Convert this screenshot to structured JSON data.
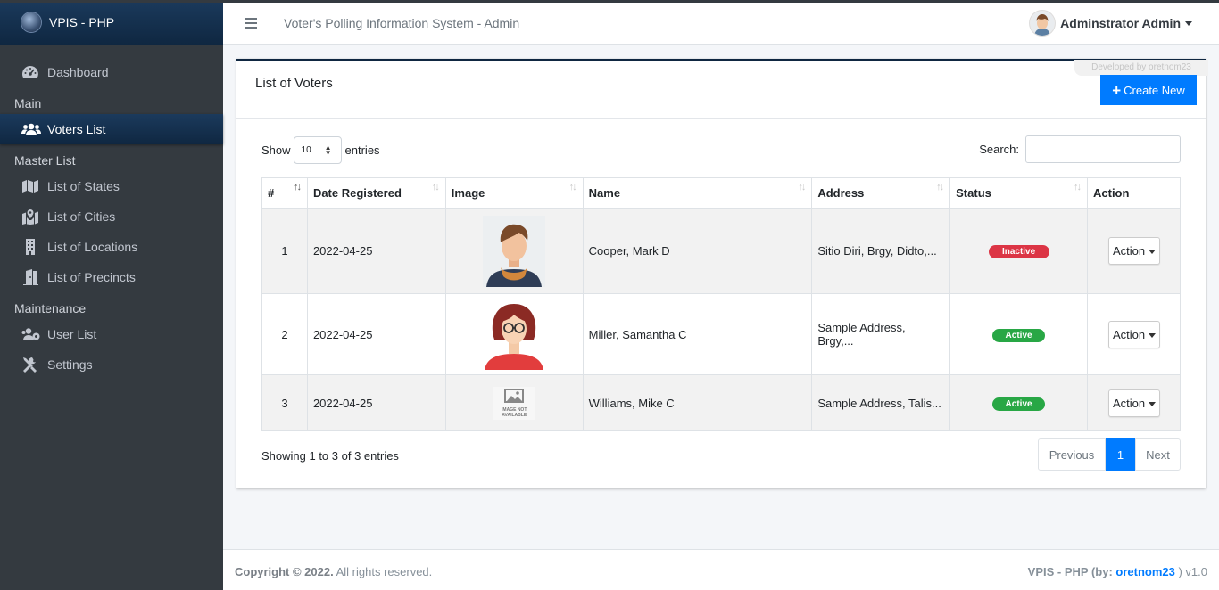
{
  "brand": {
    "title": "VPIS - PHP"
  },
  "header": {
    "system_title": "Voter's Polling Information System - Admin",
    "user_name": "Adminstrator Admin"
  },
  "sidebar": {
    "dashboard": "Dashboard",
    "main_header": "Main",
    "voters_list": "Voters List",
    "master_header": "Master List",
    "states": "List of States",
    "cities": "List of Cities",
    "locations": "List of Locations",
    "precincts": "List of Precincts",
    "maintenance_header": "Maintenance",
    "user_list": "User List",
    "settings": "Settings"
  },
  "card": {
    "title": "List of Voters",
    "create_label": "Create New",
    "developed_by": "Developed by oretnom23"
  },
  "table_controls": {
    "show_label": "Show",
    "entries_value": "10",
    "entries_label": "entries",
    "search_label": "Search:",
    "search_value": ""
  },
  "table": {
    "headers": [
      "#",
      "Date Registered",
      "Image",
      "Name",
      "Address",
      "Status",
      "Action"
    ],
    "rows": [
      {
        "no": "1",
        "date": "2022-04-25",
        "image": "male-avatar",
        "name": "Cooper, Mark D",
        "address": "Sitio Diri, Brgy, Didto,...",
        "status": "Inactive",
        "action": "Action"
      },
      {
        "no": "2",
        "date": "2022-04-25",
        "image": "female-avatar",
        "name": "Miller, Samantha C",
        "address": "Sample Address, Brgy,...",
        "status": "Active",
        "action": "Action"
      },
      {
        "no": "3",
        "date": "2022-04-25",
        "image": "image-not-available",
        "name": "Williams, Mike C",
        "address": "Sample Address, Talis...",
        "status": "Active",
        "action": "Action"
      }
    ],
    "no_image_text": "IMAGE NOT AVAILABLE"
  },
  "pagination": {
    "info": "Showing 1 to 3 of 3 entries",
    "previous": "Previous",
    "current": "1",
    "next": "Next"
  },
  "footer": {
    "copyright_bold": "Copyright © 2022.",
    "copyright_rest": " All rights reserved.",
    "credit_prefix": "VPIS - PHP (by: ",
    "credit_link": "oretnom23",
    "credit_suffix": " ) v1.0"
  },
  "colors": {
    "primary": "#007bff",
    "sidebar": "#343a40",
    "active_nav": "#0f2741",
    "danger": "#dc3545",
    "success": "#28a745"
  }
}
